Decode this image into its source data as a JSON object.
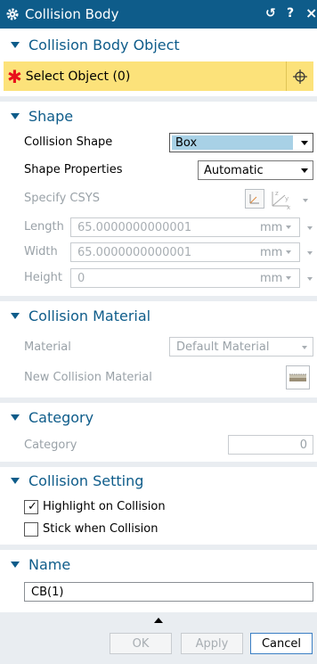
{
  "titlebar": {
    "title": "Collision Body",
    "reset_label": "↺",
    "help_label": "?",
    "close_label": "×"
  },
  "sections": {
    "object": {
      "title": "Collision Body Object",
      "select_label": "Select Object (0)"
    },
    "shape": {
      "title": "Shape",
      "collision_shape_label": "Collision Shape",
      "collision_shape_value": "Box",
      "shape_properties_label": "Shape Properties",
      "shape_properties_value": "Automatic",
      "csys_label": "Specify CSYS",
      "length_label": "Length",
      "length_value": "65.0000000000001",
      "length_unit": "mm",
      "width_label": "Width",
      "width_value": "65.0000000000001",
      "width_unit": "mm",
      "height_label": "Height",
      "height_value": "0",
      "height_unit": "mm"
    },
    "material": {
      "title": "Collision Material",
      "material_label": "Material",
      "material_value": "Default Material",
      "new_material_label": "New Collision Material"
    },
    "category": {
      "title": "Category",
      "category_label": "Category",
      "category_value": "0"
    },
    "setting": {
      "title": "Collision Setting",
      "highlight_label": "Highlight on Collision",
      "highlight_checked": true,
      "stick_label": "Stick when Collision",
      "stick_checked": false
    },
    "name": {
      "title": "Name",
      "value": "CB(1)"
    }
  },
  "footer": {
    "ok_label": "OK",
    "apply_label": "Apply",
    "cancel_label": "Cancel"
  },
  "colors": {
    "titlebar": "#0e5c8a",
    "accent": "#0e5c8a",
    "select_highlight": "#fce27a",
    "required": "#e8111b",
    "dropdown_selected": "#a8d1e6"
  }
}
